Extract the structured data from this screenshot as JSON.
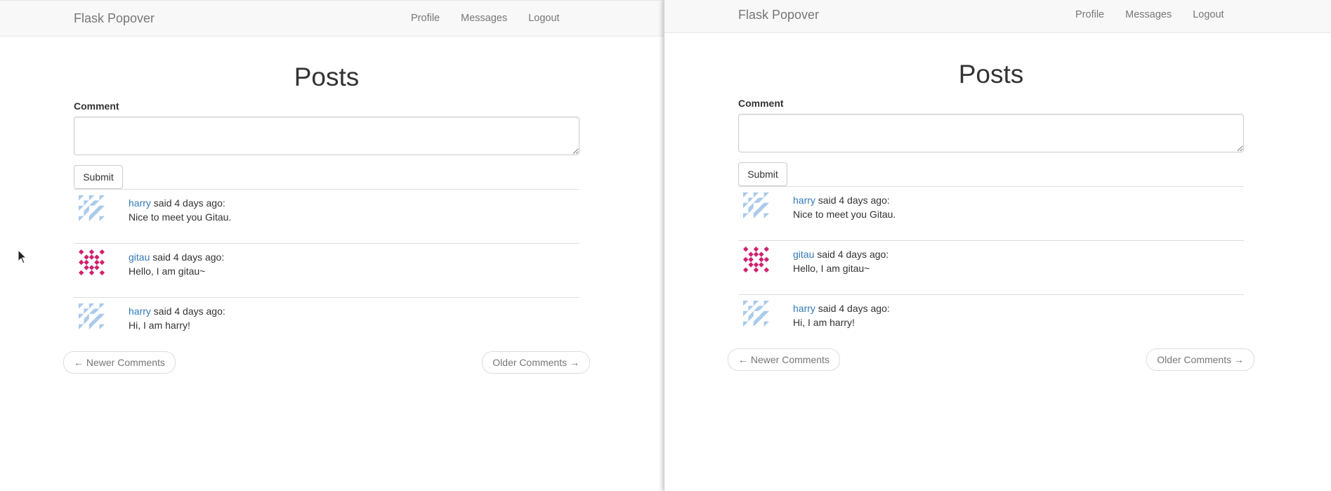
{
  "windows": [
    {
      "navbar": {
        "brand": "Flask Popover",
        "links": [
          "Profile",
          "Messages",
          "Logout"
        ]
      },
      "page_title": "Posts",
      "form": {
        "label": "Comment",
        "value": "",
        "placeholder": "",
        "submit_label": "Submit"
      },
      "comments": [
        {
          "author": "harry",
          "said": " said 4 days ago:",
          "body": "Nice to meet you Gitau.",
          "avatar_icon": "identicon-harry-icon"
        },
        {
          "author": "gitau",
          "said": " said 4 days ago:",
          "body": "Hello, I am gitau~",
          "avatar_icon": "identicon-gitau-icon"
        },
        {
          "author": "harry",
          "said": " said 4 days ago:",
          "body": "Hi, I am harry!",
          "avatar_icon": "identicon-harry-icon"
        }
      ],
      "pager": {
        "newer_label": "← Newer Comments",
        "older_label": "Older Comments →"
      }
    },
    {
      "navbar": {
        "brand": "Flask Popover",
        "links": [
          "Profile",
          "Messages",
          "Logout"
        ]
      },
      "page_title": "Posts",
      "form": {
        "label": "Comment",
        "value": "",
        "placeholder": "",
        "submit_label": "Submit"
      },
      "comments": [
        {
          "author": "harry",
          "said": " said 4 days ago:",
          "body": "Nice to meet you Gitau.",
          "avatar_icon": "identicon-harry-icon"
        },
        {
          "author": "gitau",
          "said": " said 4 days ago:",
          "body": "Hello, I am gitau~",
          "avatar_icon": "identicon-gitau-icon"
        },
        {
          "author": "harry",
          "said": " said 4 days ago:",
          "body": "Hi, I am harry!",
          "avatar_icon": "identicon-harry-icon"
        }
      ],
      "pager": {
        "newer_label": "← Newer Comments",
        "older_label": "Older Comments →"
      }
    }
  ],
  "colors": {
    "link": "#337ab7",
    "navbar_bg": "#f8f8f8",
    "navbar_text": "#777777",
    "avatar_harry": "#a9c9ea",
    "avatar_gitau": "#d21f6e"
  }
}
